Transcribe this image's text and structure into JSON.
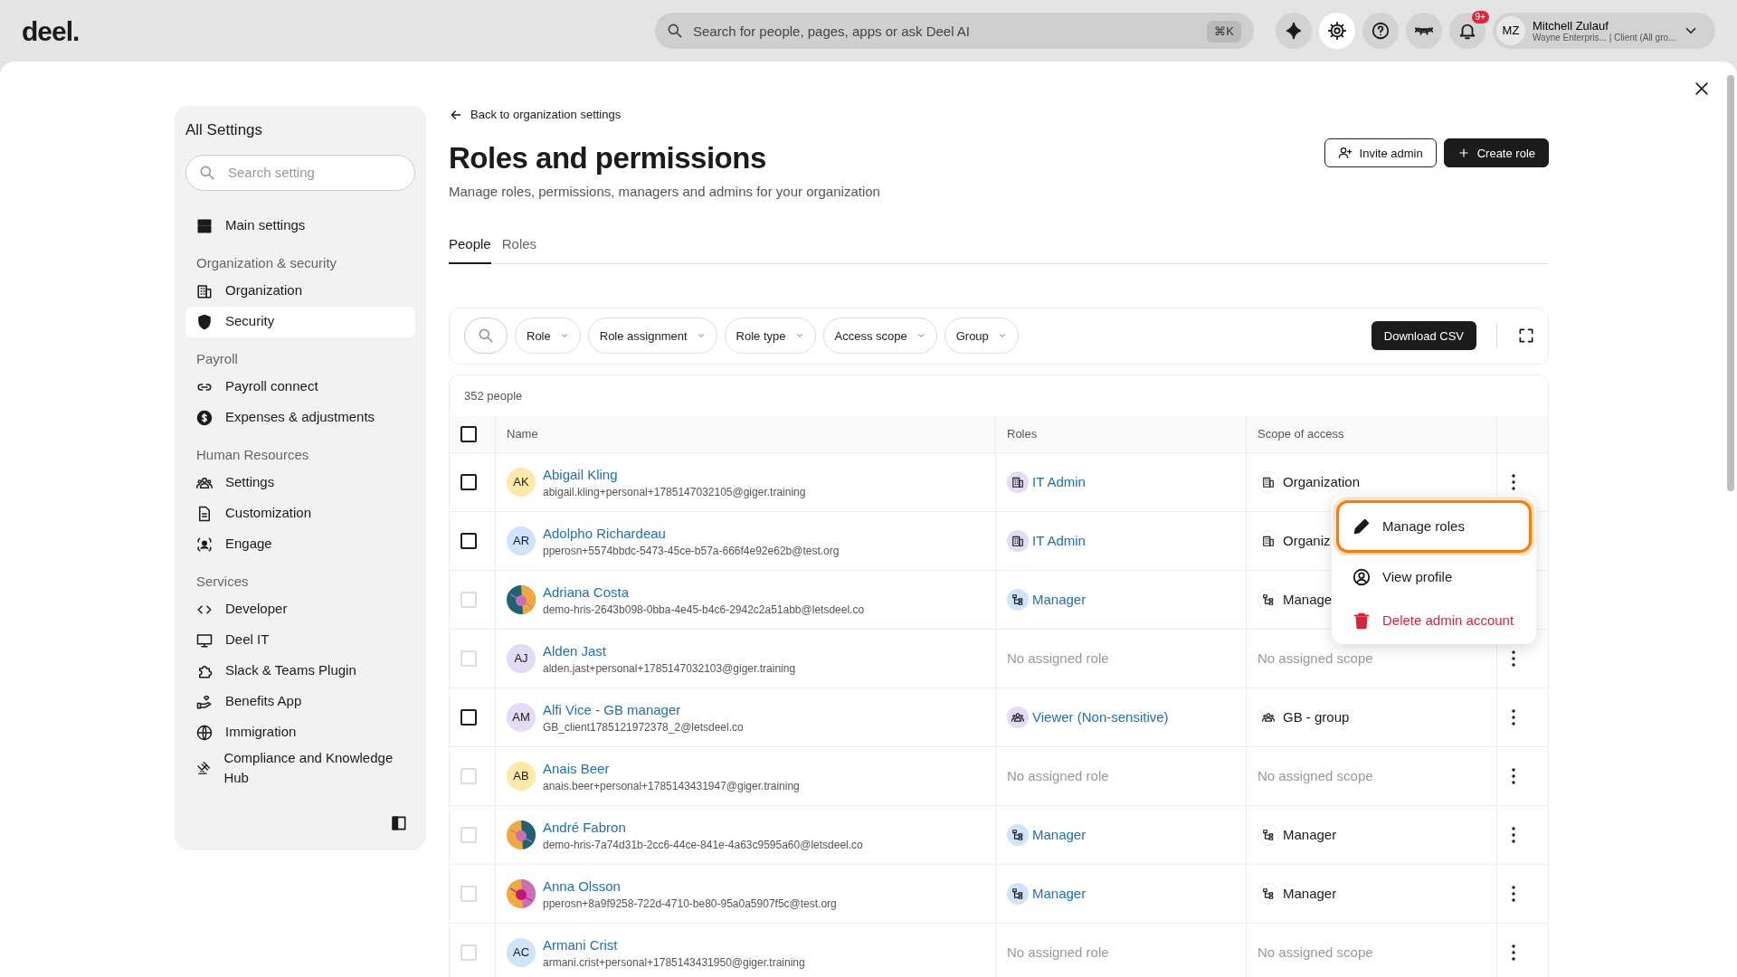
{
  "topbar": {
    "logo": "deel.",
    "search": {
      "placeholder": "Search for people, pages, apps or ask Deel AI",
      "shortcut": "⌘K"
    },
    "icons": [
      {
        "kind": "sparkle",
        "selected": false
      },
      {
        "kind": "settings",
        "selected": true
      },
      {
        "kind": "help",
        "selected": false
      },
      {
        "kind": "mask",
        "selected": false
      },
      {
        "kind": "bell",
        "selected": false,
        "badge": "9+"
      }
    ],
    "user": {
      "initials": "MZ",
      "name": "Mitchell Zulauf",
      "subtitle": "Wayne Enterpris... | Client (All gro..."
    }
  },
  "sidebar": {
    "title": "All Settings",
    "search": {
      "placeholder": "Search setting"
    },
    "groups": [
      {
        "items": [
          {
            "label": "Main settings",
            "selected": false
          }
        ]
      },
      {
        "heading": "Organization & security",
        "items": [
          {
            "label": "Organization",
            "selected": false
          },
          {
            "label": "Security",
            "selected": true
          }
        ]
      },
      {
        "heading": "Payroll",
        "items": [
          {
            "label": "Payroll connect",
            "selected": false
          },
          {
            "label": "Expenses & adjustments",
            "selected": false
          }
        ]
      },
      {
        "heading": "Human Resources",
        "items": [
          {
            "label": "Settings",
            "selected": false
          },
          {
            "label": "Customization",
            "selected": false
          },
          {
            "label": "Engage",
            "selected": false
          }
        ]
      },
      {
        "heading": "Services",
        "items": [
          {
            "label": "Developer",
            "selected": false
          },
          {
            "label": "Deel IT",
            "selected": false
          },
          {
            "label": "Slack & Teams Plugin",
            "selected": false
          },
          {
            "label": "Benefits App",
            "selected": false
          },
          {
            "label": "Immigration",
            "selected": false
          },
          {
            "label": "Compliance and Knowledge Hub",
            "selected": false
          }
        ]
      }
    ]
  },
  "page": {
    "back_link": "Back to organization settings",
    "title": "Roles and permissions",
    "subtitle": "Manage roles, permissions, managers and admins for your organization",
    "actions": [
      {
        "label": "Invite admin",
        "kind": "outline"
      },
      {
        "label": "Create role",
        "kind": "primary"
      }
    ],
    "tabs": [
      {
        "label": "People",
        "selected": true
      },
      {
        "label": "Roles",
        "selected": false
      }
    ]
  },
  "filters": {
    "chips": [
      "Role",
      "Role assignment",
      "Role type",
      "Access scope",
      "Group"
    ],
    "download": "Download CSV"
  },
  "table": {
    "count": "352 people",
    "columns": [
      "Name",
      "Roles",
      "Scope of access"
    ],
    "header_checkbox": {
      "checked": false
    },
    "rows": [
      {
        "checkbox": {
          "checked": false,
          "disabled": false
        },
        "avatar": {
          "kind": "initials",
          "initials": "AK",
          "color": "#fdeaa8"
        },
        "name": "Abigail Kling",
        "email": "abigail.kling+personal+1785147032105@giger.training",
        "role": {
          "kind": "org",
          "label": "IT Admin"
        },
        "scope": {
          "kind": "org",
          "label": "Organization"
        },
        "menu": true
      },
      {
        "checkbox": {
          "checked": false,
          "disabled": false
        },
        "avatar": {
          "kind": "initials",
          "initials": "AR",
          "color": "#cfe3fb"
        },
        "name": "Adolpho Richardeau",
        "email": "pperosn+5574bbdc-5473-45ce-b57a-666f4e92e62b@test.org",
        "role": {
          "kind": "org",
          "label": "IT Admin"
        },
        "scope": {
          "kind": "org",
          "label": "Organiz"
        },
        "menu": false
      },
      {
        "checkbox": {
          "checked": false,
          "disabled": true
        },
        "name": "Adriana Costa",
        "email": "demo-hris-2643b098-0bba-4e45-b4c6-2942c2a51abb@letsdeel.co",
        "role": {
          "kind": "manager",
          "label": "Manager"
        },
        "scope": {
          "kind": "manager",
          "label": "Manage"
        },
        "menu": false
      },
      {
        "checkbox": {
          "checked": false,
          "disabled": true
        },
        "avatar": {
          "kind": "initials",
          "initials": "AJ",
          "color": "#e3dbf7"
        },
        "name": "Alden Jast",
        "email": "alden.jast+personal+1785147032103@giger.training",
        "role": {
          "kind": "none",
          "label": "No assigned role"
        },
        "scope": {
          "kind": "none",
          "label": "No assigned scope"
        },
        "menu": true
      },
      {
        "checkbox": {
          "checked": false,
          "disabled": false
        },
        "avatar": {
          "kind": "initials",
          "initials": "AM",
          "color": "#e3dbf7"
        },
        "name": "Alfi Vice - GB manager",
        "email": "GB_client1785121972378_2@letsdeel.co",
        "role": {
          "kind": "group",
          "label": "Viewer (Non-sensitive)"
        },
        "scope": {
          "kind": "group",
          "label": "GB - group"
        },
        "menu": true
      },
      {
        "checkbox": {
          "checked": false,
          "disabled": true
        },
        "avatar": {
          "kind": "initials",
          "initials": "AB",
          "color": "#fdeaa8"
        },
        "name": "Anais Beer",
        "email": "anais.beer+personal+1785143431947@giger.training",
        "role": {
          "kind": "none",
          "label": "No assigned role"
        },
        "scope": {
          "kind": "none",
          "label": "No assigned scope"
        },
        "menu": true
      },
      {
        "checkbox": {
          "checked": false,
          "disabled": true
        },
        "name": "André Fabron",
        "email": "demo-hris-7a74d31b-2cc6-44ce-841e-4a63c9595a60@letsdeel.co",
        "role": {
          "kind": "manager",
          "label": "Manager"
        },
        "scope": {
          "kind": "manager",
          "label": "Manager"
        },
        "menu": true
      },
      {
        "checkbox": {
          "checked": false,
          "disabled": true
        },
        "name": "Anna Olsson",
        "email": "pperosn+8a9f9258-722d-4710-be80-95a0a5907f5c@test.org",
        "role": {
          "kind": "manager",
          "label": "Manager"
        },
        "scope": {
          "kind": "manager",
          "label": "Manager"
        },
        "menu": true
      },
      {
        "checkbox": {
          "checked": false,
          "disabled": true
        },
        "avatar": {
          "kind": "initials",
          "initials": "AC",
          "color": "#cfe3fb"
        },
        "name": "Armani Crist",
        "email": "armani.crist+personal+1785143431950@giger.training",
        "role": {
          "kind": "none",
          "label": "No assigned role"
        },
        "scope": {
          "kind": "none",
          "label": "No assigned scope"
        },
        "menu": true
      }
    ]
  },
  "row_menu": {
    "items": [
      {
        "kind": "edit",
        "label": "Manage roles",
        "focused": true
      },
      {
        "kind": "profile",
        "label": "View profile",
        "focused": false
      },
      {
        "kind": "delete",
        "label": "Delete admin account",
        "focused": false
      }
    ]
  }
}
